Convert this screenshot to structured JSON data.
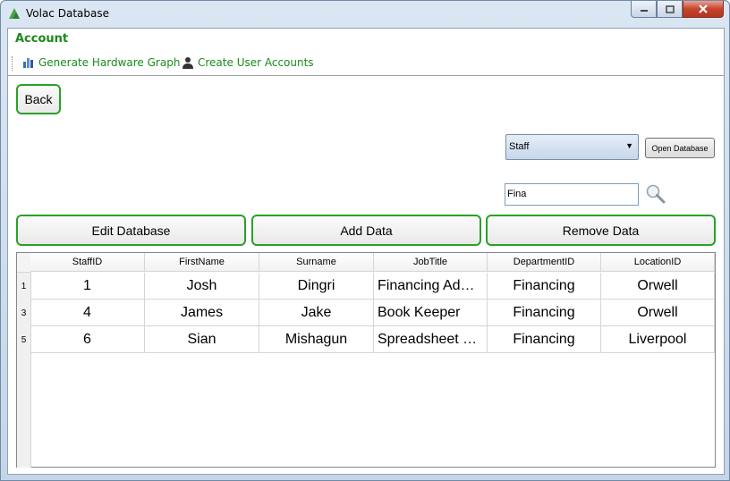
{
  "window": {
    "title": "Volac Database",
    "minimize_icon": "minimize-icon",
    "maximize_icon": "maximize-icon",
    "close_icon": "close-icon"
  },
  "ribbon": {
    "title": "Account",
    "items": [
      {
        "label": "Generate Hardware Graph",
        "icon": "bar-chart-icon"
      },
      {
        "label": "Create User Accounts",
        "icon": "users-icon"
      }
    ]
  },
  "back_label": "Back",
  "table_select": {
    "value": "Staff"
  },
  "open_database_label": "Open Database",
  "search": {
    "value": "Fina"
  },
  "actions": {
    "edit": "Edit Database",
    "add": "Add Data",
    "remove": "Remove Data"
  },
  "grid": {
    "columns": [
      "StaffID",
      "FirstName",
      "Surname",
      "JobTitle",
      "DepartmentID",
      "LocationID"
    ],
    "rows": [
      {
        "num": "1",
        "cells": [
          "1",
          "Josh",
          "Dingri",
          "Financing Ad…",
          "Financing",
          "Orwell"
        ]
      },
      {
        "num": "3",
        "cells": [
          "4",
          "James",
          "Jake",
          "Book Keeper",
          "Financing",
          "Orwell"
        ]
      },
      {
        "num": "5",
        "cells": [
          "6",
          "Sian",
          "Mishagun",
          "Spreadsheet …",
          "Financing",
          "Liverpool"
        ]
      }
    ]
  },
  "colors": {
    "accent_green": "#2aa02a",
    "title_green": "#1a8a1a"
  }
}
